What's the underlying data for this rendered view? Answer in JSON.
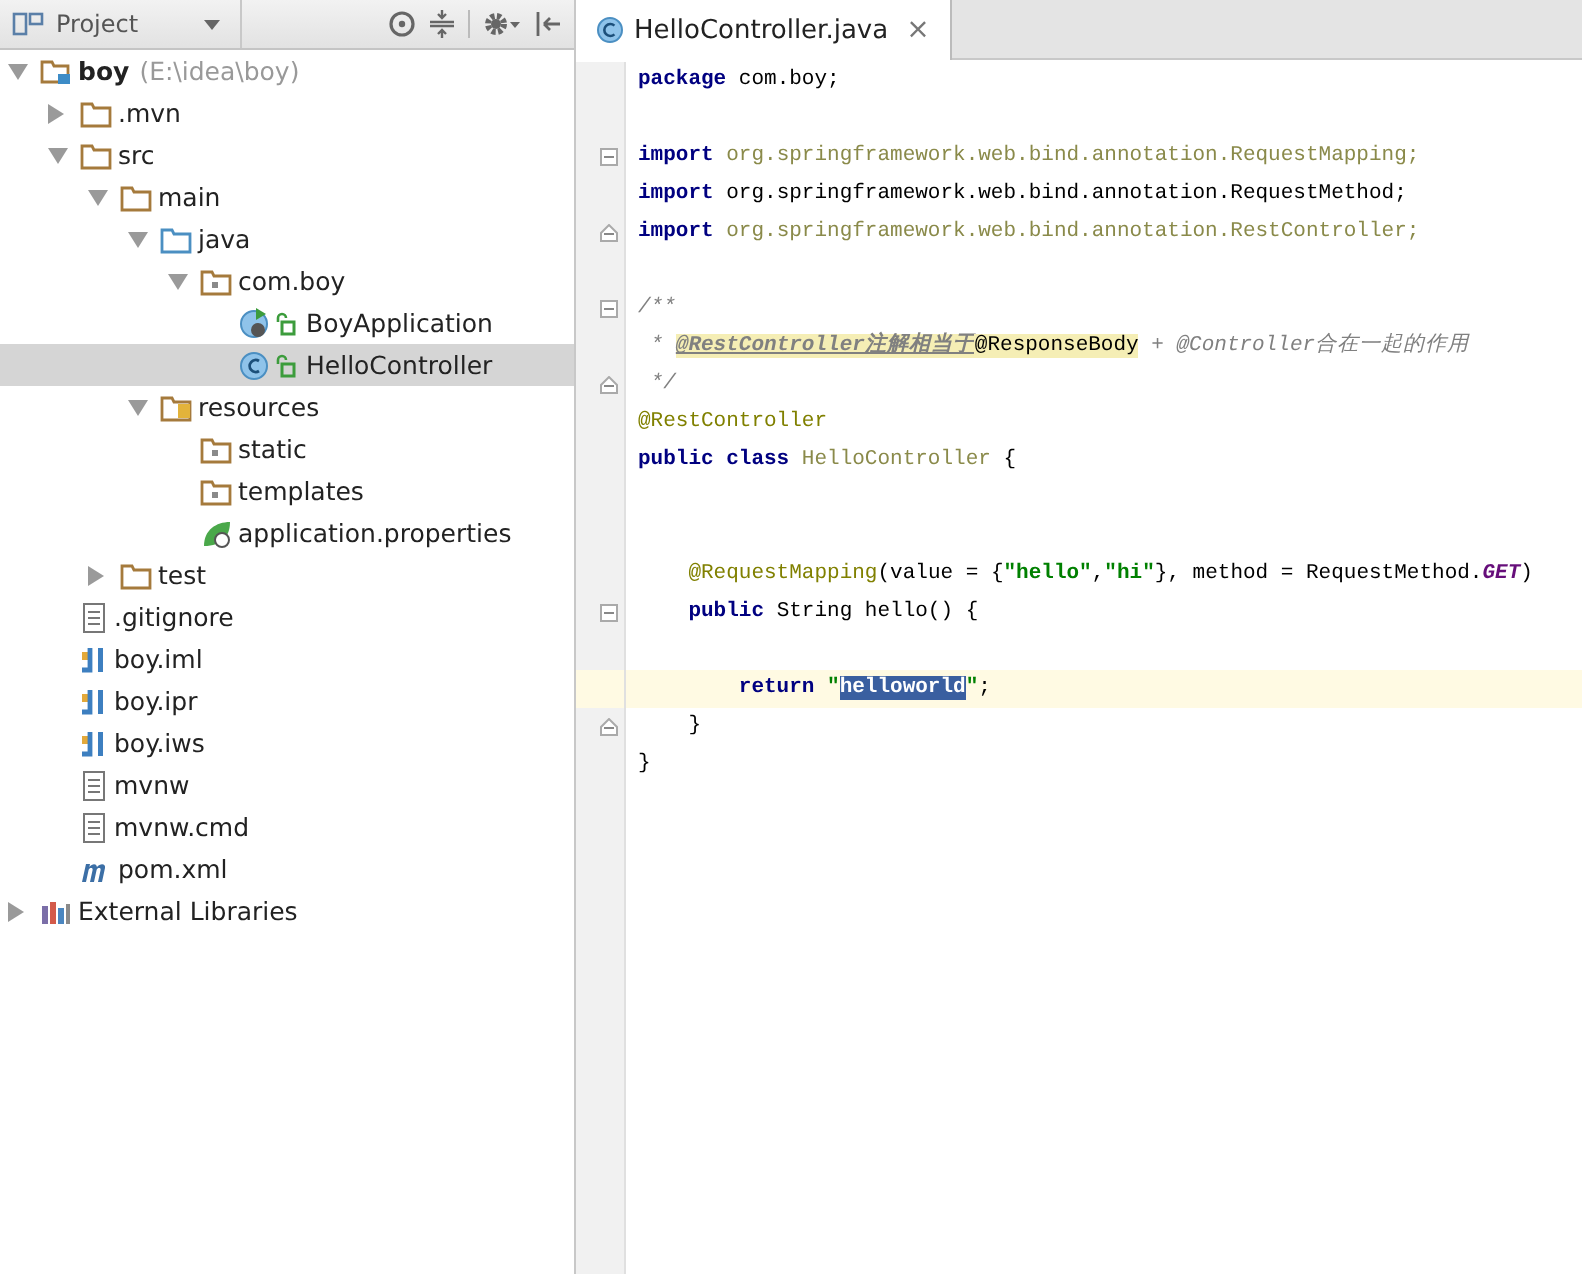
{
  "project_panel": {
    "title": "Project"
  },
  "tree": [
    {
      "label": "boy",
      "hint": "(E:\\idea\\boy)",
      "kind": "project",
      "expanded": true,
      "selected": false,
      "children": [
        {
          "label": ".mvn",
          "kind": "folder",
          "expanded": false,
          "selected": false
        },
        {
          "label": "src",
          "kind": "folder",
          "expanded": true,
          "selected": false,
          "children": [
            {
              "label": "main",
              "kind": "folder",
              "expanded": true,
              "selected": false,
              "children": [
                {
                  "label": "java",
                  "kind": "source-folder",
                  "expanded": true,
                  "selected": false,
                  "children": [
                    {
                      "label": "com.boy",
                      "kind": "package",
                      "expanded": true,
                      "selected": false,
                      "children": [
                        {
                          "label": "BoyApplication",
                          "kind": "spring-app-class",
                          "selected": false
                        },
                        {
                          "label": "HelloController",
                          "kind": "class",
                          "selected": true
                        }
                      ]
                    }
                  ]
                },
                {
                  "label": "resources",
                  "kind": "resources-folder",
                  "expanded": true,
                  "selected": false,
                  "children": [
                    {
                      "label": "static",
                      "kind": "package",
                      "selected": false
                    },
                    {
                      "label": "templates",
                      "kind": "package",
                      "selected": false
                    },
                    {
                      "label": "application.properties",
                      "kind": "properties",
                      "selected": false
                    }
                  ]
                }
              ]
            },
            {
              "label": "test",
              "kind": "folder",
              "expanded": false,
              "selected": false
            }
          ]
        },
        {
          "label": ".gitignore",
          "kind": "text-file",
          "selected": false
        },
        {
          "label": "boy.iml",
          "kind": "module-file",
          "selected": false
        },
        {
          "label": "boy.ipr",
          "kind": "module-file",
          "selected": false
        },
        {
          "label": "boy.iws",
          "kind": "module-file",
          "selected": false
        },
        {
          "label": "mvnw",
          "kind": "text-file",
          "selected": false
        },
        {
          "label": "mvnw.cmd",
          "kind": "text-file",
          "selected": false
        },
        {
          "label": "pom.xml",
          "kind": "maven-file",
          "selected": false
        }
      ]
    },
    {
      "label": "External Libraries",
      "kind": "libraries",
      "expanded": false,
      "selected": false
    }
  ],
  "editor_tab": {
    "label": "HelloController.java",
    "close": "×",
    "selected": true
  },
  "code_lines": [
    {
      "kind": "code",
      "tokens": [
        {
          "text": "package",
          "kind": "keyword"
        },
        {
          "text": " com.boy;",
          "kind": "plain"
        }
      ]
    },
    {
      "kind": "blank"
    },
    {
      "kind": "code",
      "fold_start": true,
      "tokens": [
        {
          "text": "import",
          "kind": "keyword"
        },
        {
          "text": " org.springframework.web.bind.annotation.RequestMapping;",
          "kind": "unused"
        }
      ]
    },
    {
      "kind": "code",
      "tokens": [
        {
          "text": "import",
          "kind": "keyword"
        },
        {
          "text": " org.springframework.web.bind.annotation.RequestMethod;",
          "kind": "plain"
        }
      ]
    },
    {
      "kind": "code",
      "fold_end": true,
      "tokens": [
        {
          "text": "import",
          "kind": "keyword"
        },
        {
          "text": " org.springframework.web.bind.annotation.RestController;",
          "kind": "unused"
        }
      ]
    },
    {
      "kind": "blank"
    },
    {
      "kind": "code",
      "fold_start": true,
      "tokens": [
        {
          "text": "/**",
          "kind": "comment"
        }
      ]
    },
    {
      "kind": "code",
      "tokens": [
        {
          "text": " * ",
          "kind": "comment"
        },
        {
          "text": "@RestController注解相当于",
          "kind": "doc-link"
        },
        {
          "text": "@ResponseBody",
          "kind": "highlight"
        },
        {
          "text": " + @Controller合在一起的作用",
          "kind": "comment"
        }
      ]
    },
    {
      "kind": "code",
      "fold_end": true,
      "tokens": [
        {
          "text": " */",
          "kind": "comment"
        }
      ]
    },
    {
      "kind": "code",
      "tokens": [
        {
          "text": "@RestController",
          "kind": "annotation"
        }
      ]
    },
    {
      "kind": "code",
      "tokens": [
        {
          "text": "public class ",
          "kind": "keyword"
        },
        {
          "text": "HelloController",
          "kind": "unused"
        },
        {
          "text": " {",
          "kind": "plain"
        }
      ]
    },
    {
      "kind": "blank"
    },
    {
      "kind": "blank"
    },
    {
      "kind": "code",
      "tokens": [
        {
          "text": "    @RequestMapping",
          "kind": "annotation"
        },
        {
          "text": "(value = {",
          "kind": "plain"
        },
        {
          "text": "\"hello\"",
          "kind": "string"
        },
        {
          "text": ",",
          "kind": "plain"
        },
        {
          "text": "\"hi\"",
          "kind": "string"
        },
        {
          "text": "}, method = RequestMethod.",
          "kind": "plain"
        },
        {
          "text": "GET",
          "kind": "constant"
        },
        {
          "text": ")",
          "kind": "plain"
        }
      ]
    },
    {
      "kind": "code",
      "fold_start": true,
      "tokens": [
        {
          "text": "    public",
          "kind": "keyword"
        },
        {
          "text": " String hello() {",
          "kind": "plain"
        }
      ]
    },
    {
      "kind": "blank"
    },
    {
      "kind": "code",
      "current": true,
      "tokens": [
        {
          "text": "        return ",
          "kind": "keyword"
        },
        {
          "text": "\"",
          "kind": "string"
        },
        {
          "text": "helloworld",
          "kind": "selection"
        },
        {
          "text": "\"",
          "kind": "string"
        },
        {
          "text": ";",
          "kind": "plain"
        }
      ]
    },
    {
      "kind": "code",
      "fold_end": true,
      "tokens": [
        {
          "text": "    }",
          "kind": "plain"
        }
      ]
    },
    {
      "kind": "code",
      "tokens": [
        {
          "text": "}",
          "kind": "plain"
        }
      ]
    }
  ]
}
